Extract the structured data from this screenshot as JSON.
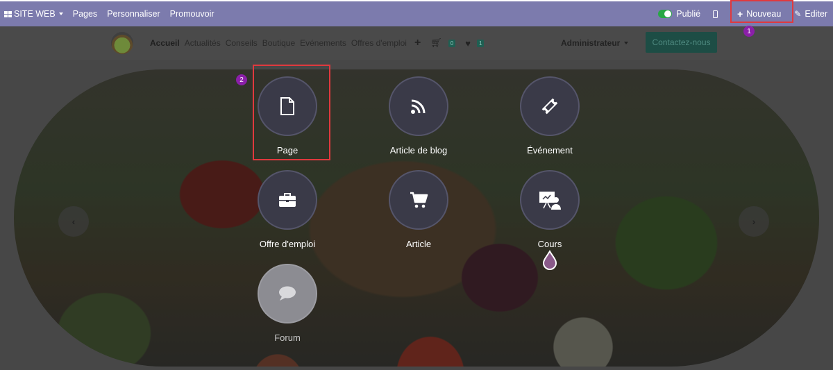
{
  "admin_bar": {
    "site_menu": "SITE WEB",
    "pages": "Pages",
    "personnaliser": "Personnaliser",
    "promouvoir": "Promouvoir",
    "publie": "Publié",
    "nouveau": "Nouveau",
    "editer": "Editer"
  },
  "steps": {
    "one": "1",
    "two": "2"
  },
  "site_header": {
    "menu": [
      "Accueil",
      "Actualités",
      "Conseils",
      "Boutique",
      "Evénements",
      "Offres d'emploi"
    ],
    "add_menu": "+",
    "cart_count": "0",
    "wishlist_count": "1",
    "user": "Administrateur",
    "contact": "Contactez-nous"
  },
  "new_content": {
    "page": "Page",
    "blog": "Article de blog",
    "event": "Événement",
    "job": "Offre d'emploi",
    "product": "Article",
    "course": "Cours",
    "forum": "Forum"
  },
  "colors": {
    "admin_bar": "#7c7bad",
    "highlight": "#e0393e",
    "step_badge": "#8b1fa9",
    "circle": "#3a3a48",
    "contact_button": "#1d4d45"
  },
  "icons": {
    "page": "file-icon",
    "blog": "rss-icon",
    "event": "ticket-icon",
    "job": "briefcase-icon",
    "product": "cart-icon",
    "course": "presentation-icon",
    "forum": "chat-bubble-icon"
  }
}
